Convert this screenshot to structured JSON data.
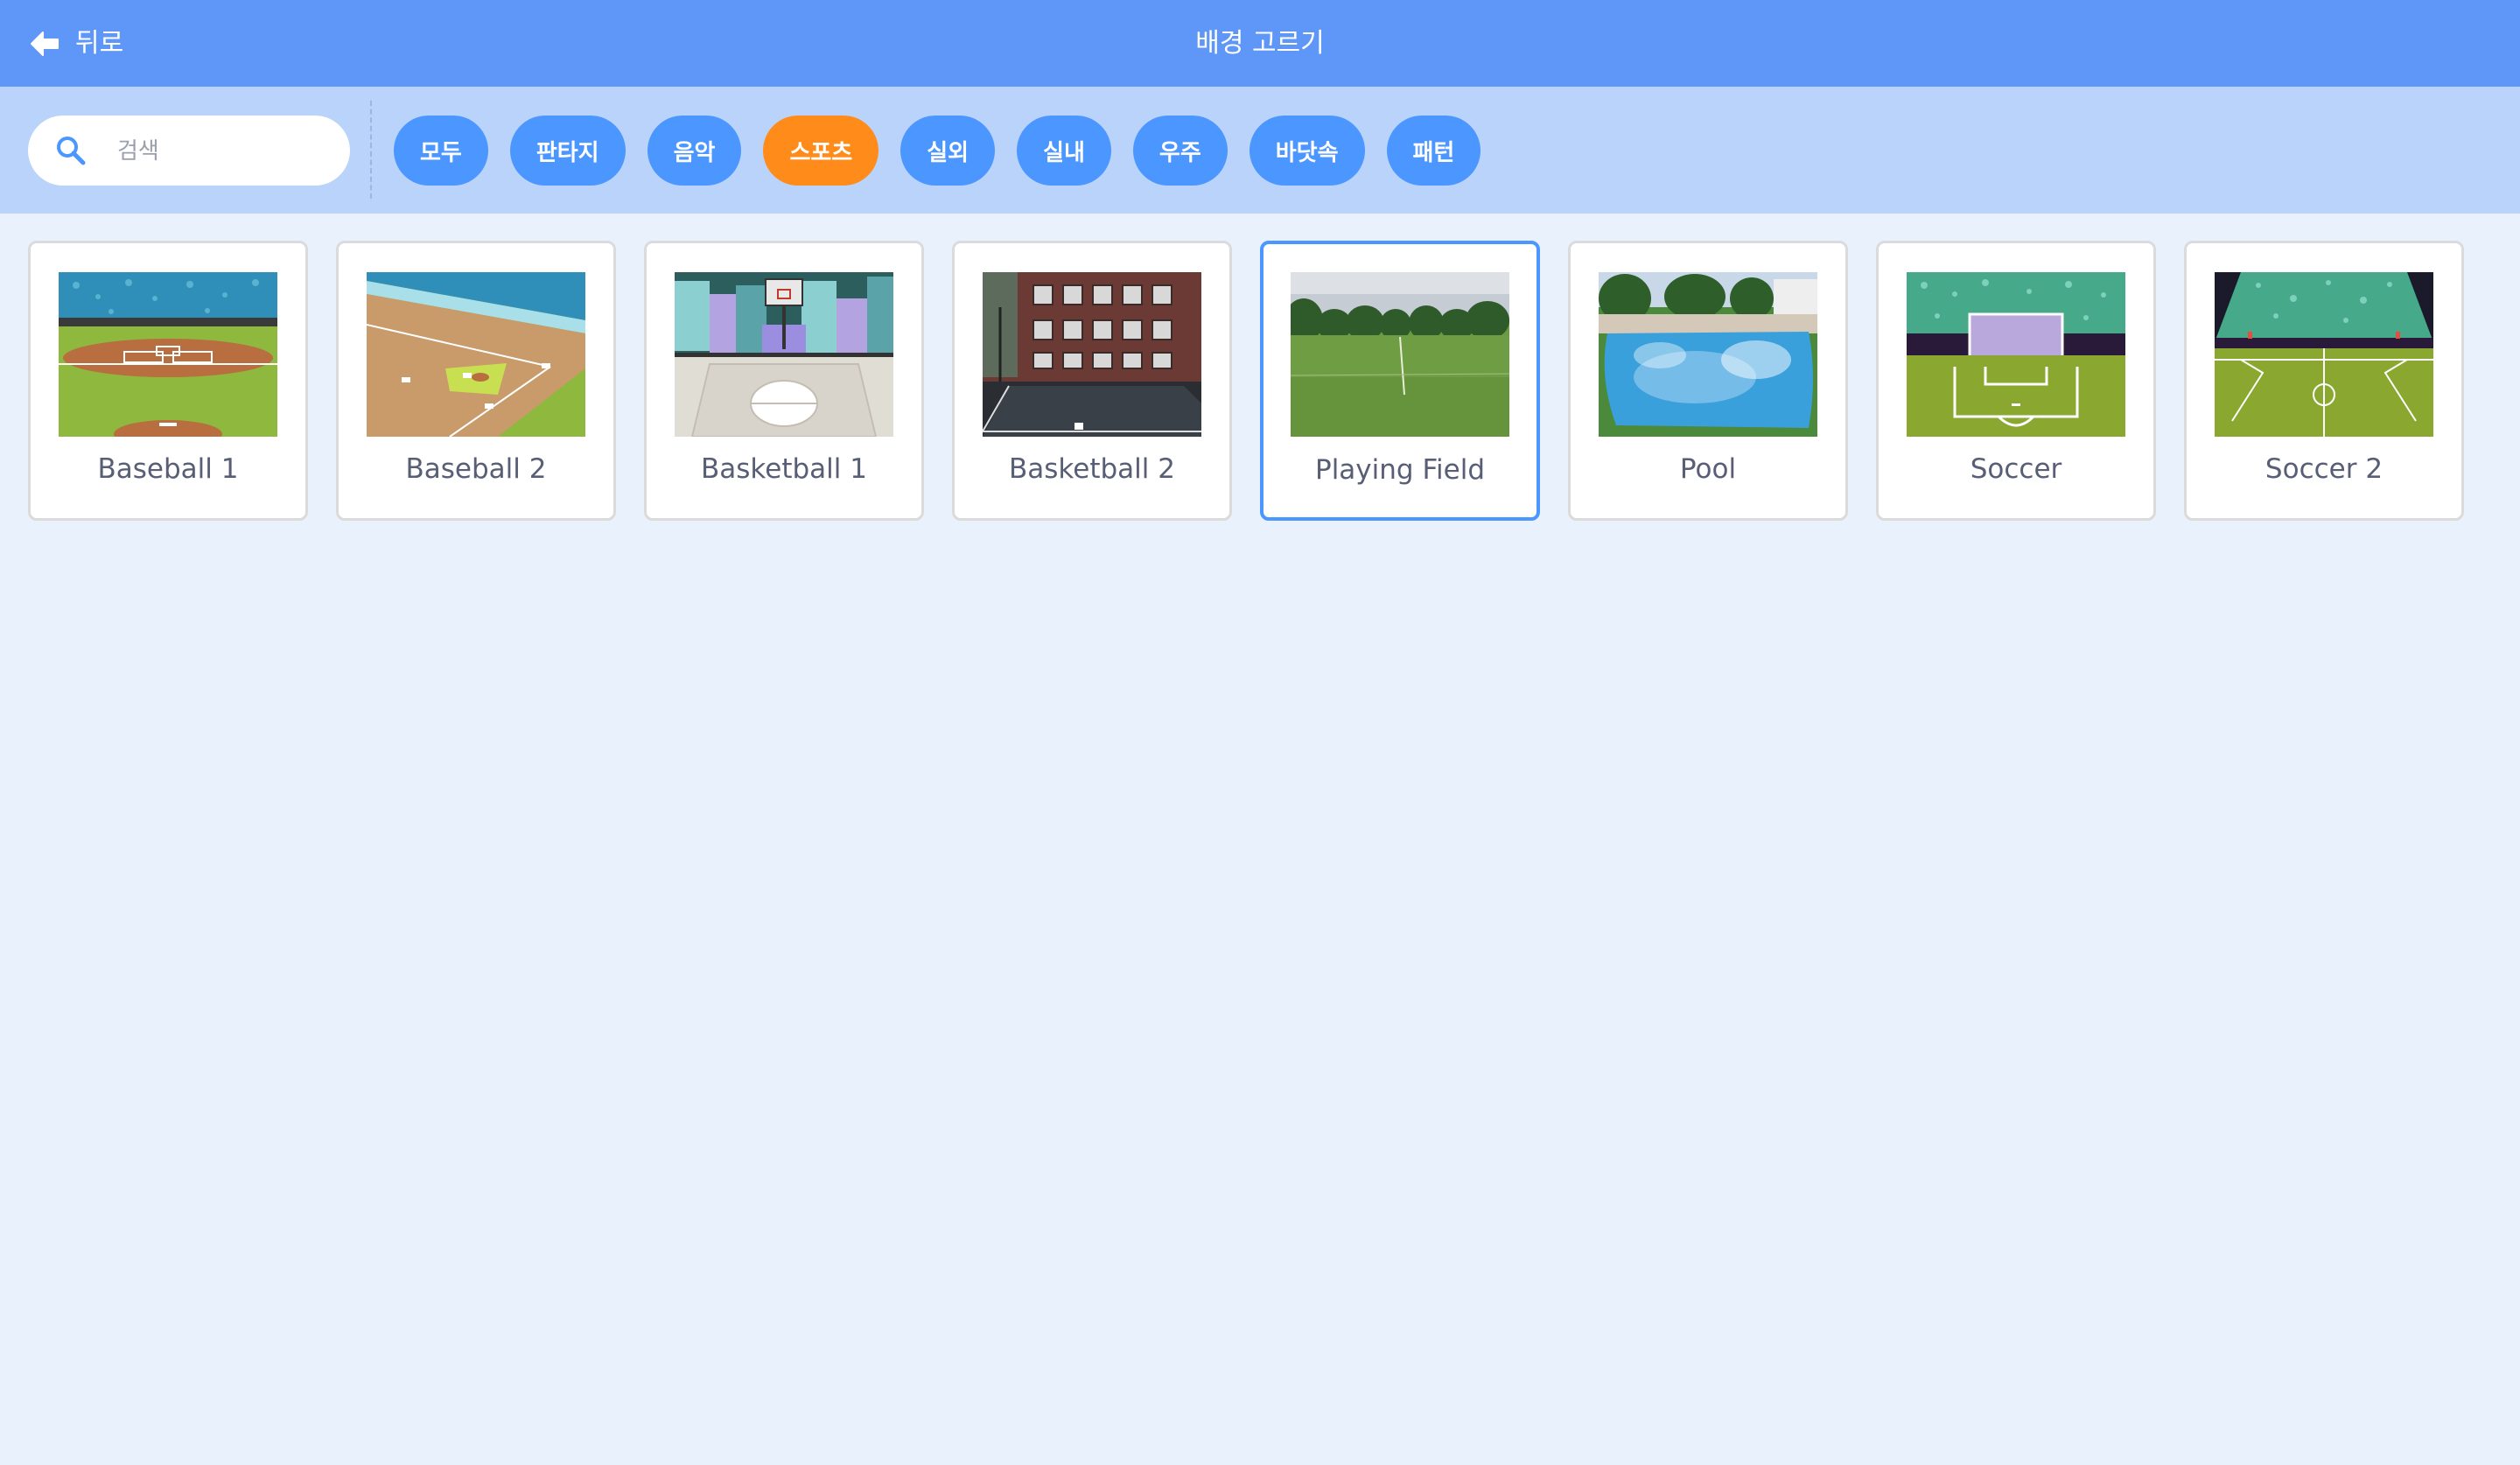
{
  "header": {
    "back_label": "뒤로",
    "title": "배경 고르기"
  },
  "search": {
    "placeholder": "검색",
    "value": ""
  },
  "tags": [
    {
      "label": "모두",
      "active": false
    },
    {
      "label": "판타지",
      "active": false
    },
    {
      "label": "음악",
      "active": false
    },
    {
      "label": "스포츠",
      "active": true
    },
    {
      "label": "실외",
      "active": false
    },
    {
      "label": "실내",
      "active": false
    },
    {
      "label": "우주",
      "active": false
    },
    {
      "label": "바닷속",
      "active": false
    },
    {
      "label": "패턴",
      "active": false
    }
  ],
  "backdrops": [
    {
      "name": "Baseball 1",
      "thumbnail": "baseball-1-thumbnail",
      "selected": false
    },
    {
      "name": "Baseball 2",
      "thumbnail": "baseball-2-thumbnail",
      "selected": false
    },
    {
      "name": "Basketball 1",
      "thumbnail": "basketball-1-thumbnail",
      "selected": false
    },
    {
      "name": "Basketball 2",
      "thumbnail": "basketball-2-thumbnail",
      "selected": false
    },
    {
      "name": "Playing Field",
      "thumbnail": "playing-field-thumbnail",
      "selected": true
    },
    {
      "name": "Pool",
      "thumbnail": "pool-thumbnail",
      "selected": false
    },
    {
      "name": "Soccer",
      "thumbnail": "soccer-thumbnail",
      "selected": false
    },
    {
      "name": "Soccer 2",
      "thumbnail": "soccer-2-thumbnail",
      "selected": false
    }
  ],
  "colors": {
    "header_bg": "#5e97f7",
    "filter_bg": "#b9d3fa",
    "page_bg": "#e9f1fc",
    "tag_bg": "#4c97ff",
    "tag_active_bg": "#ff8c1a",
    "selected_border": "#4c97ff",
    "label_text": "#575e75"
  },
  "icons": {
    "back": "arrow-left-icon",
    "search": "magnifier-icon"
  }
}
